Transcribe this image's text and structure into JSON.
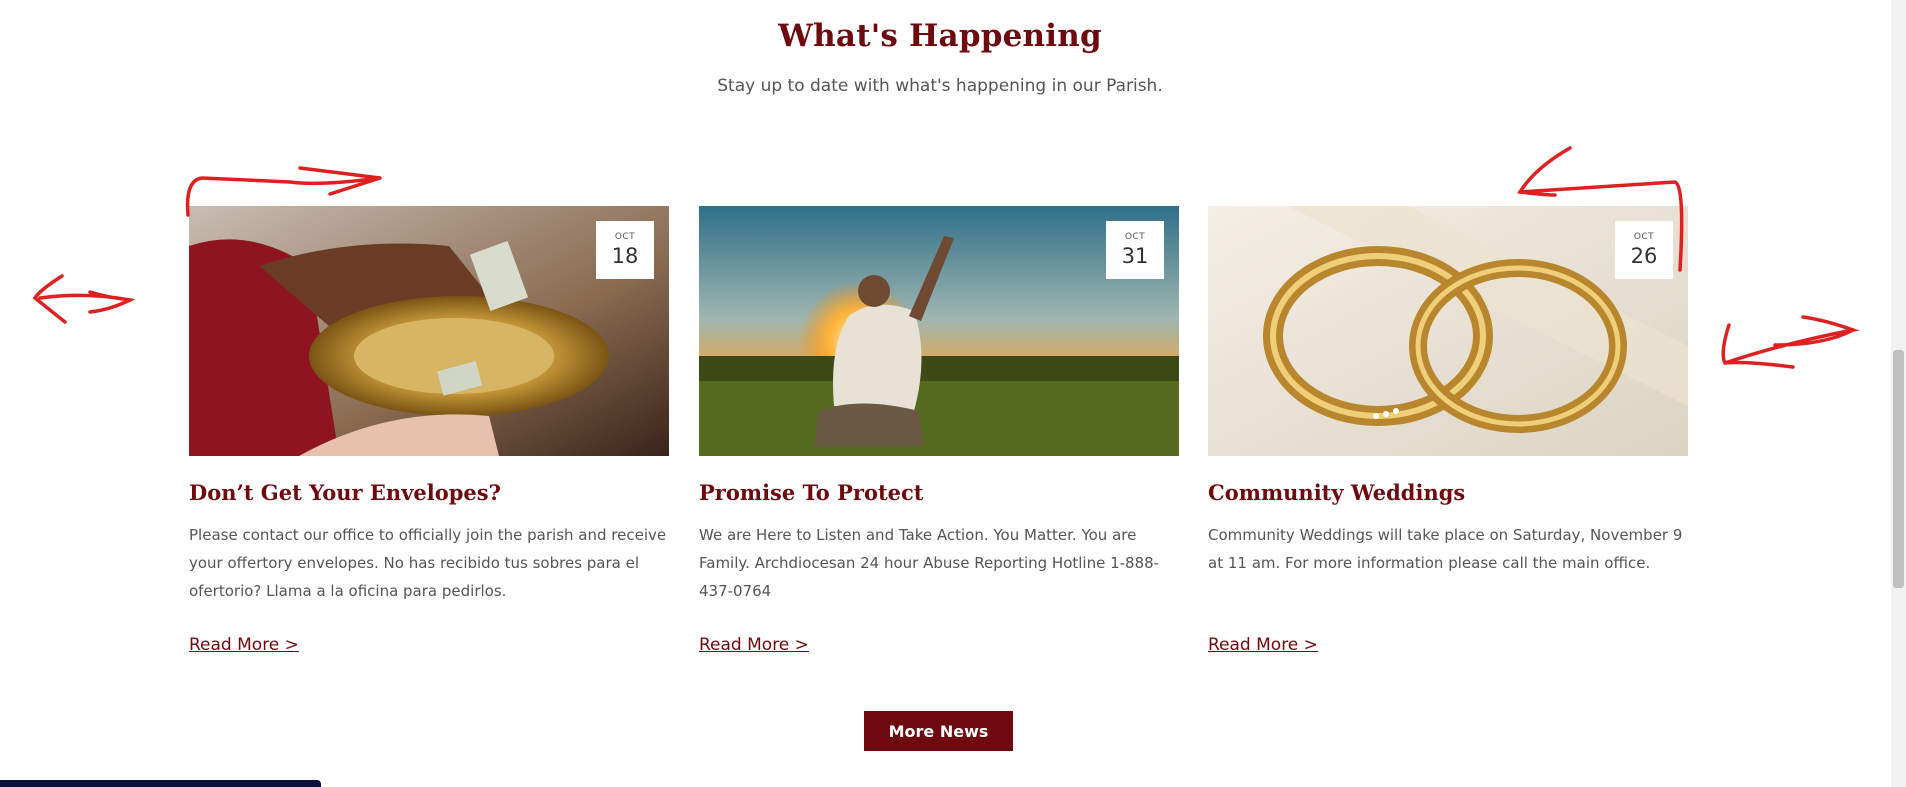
{
  "section": {
    "title": "What's Happening",
    "subtitle": "Stay up to date with what's happening in our Parish."
  },
  "cards": [
    {
      "month": "OCT",
      "day": "18",
      "title": "Don’t Get Your Envelopes?",
      "text": "Please contact our office to officially join the parish and receive your offertory envelopes. No has recibido tus sobres para el ofertorio? Llama a la oficina para pedirlos.",
      "link": "Read More >"
    },
    {
      "month": "OCT",
      "day": "31",
      "title": "Promise To Protect",
      "text": "We are Here to Listen and Take Action. You Matter. You are Family. Archdiocesan 24 hour Abuse Reporting Hotline 1-888-437-0764",
      "link": "Read More >"
    },
    {
      "month": "OCT",
      "day": "26",
      "title": "Community Weddings",
      "text": "Community Weddings will take place on Saturday, November 9 at 11 am. For more information please call the main office.",
      "link": "Read More >"
    }
  ],
  "more_button": "More News",
  "colors": {
    "brand": "#6e0a0f",
    "annotation": "#e02020",
    "status_bar": "#0b0f3a"
  }
}
